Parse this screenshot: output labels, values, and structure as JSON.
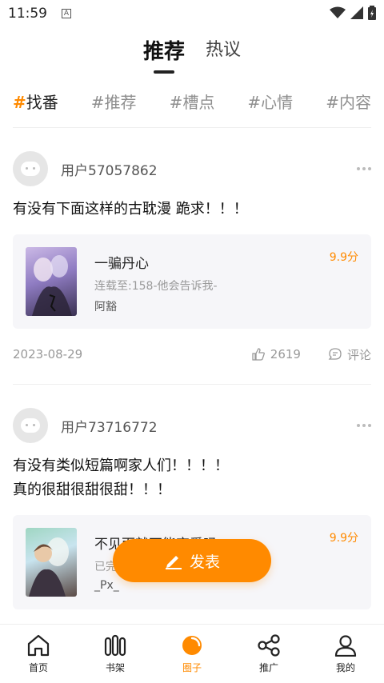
{
  "status_bar": {
    "time": "11:59",
    "notification_icon": "A"
  },
  "top_tabs": [
    {
      "label": "推荐",
      "active": true
    },
    {
      "label": "热议",
      "active": false
    }
  ],
  "hashtags": [
    {
      "hash": "#",
      "label": "找番",
      "active": true
    },
    {
      "hash": "#",
      "label": "推荐",
      "active": false
    },
    {
      "hash": "#",
      "label": "槽点",
      "active": false
    },
    {
      "hash": "#",
      "label": "心情",
      "active": false
    },
    {
      "hash": "#",
      "label": "内容",
      "active": false
    }
  ],
  "posts": [
    {
      "username": "用户57057862",
      "lines": [
        "有没有下面这样的古耽漫 跪求！！！"
      ],
      "comic": {
        "title": "一骗丹心",
        "progress": "连载至:158-他会告诉我-",
        "author": "阿豁",
        "score": "9.9分"
      },
      "date": "2023-08-29",
      "likes": "2619",
      "comment_label": "评论"
    },
    {
      "username": "用户73716772",
      "lines": [
        "有没有类似短篇啊家人们！！！！",
        "真的很甜很甜很甜！！！"
      ],
      "comic": {
        "title": "不见面就不能恋爱吗",
        "progress": "已完结",
        "author": "_Px_",
        "score": "9.9分"
      }
    }
  ],
  "publish_button": {
    "label": "发表"
  },
  "bottom_nav": [
    {
      "label": "首页",
      "icon": "home-icon",
      "active": false
    },
    {
      "label": "书架",
      "icon": "bookshelf-icon",
      "active": false
    },
    {
      "label": "圈子",
      "icon": "circle-icon",
      "active": true
    },
    {
      "label": "推广",
      "icon": "share-icon",
      "active": false
    },
    {
      "label": "我的",
      "icon": "profile-icon",
      "active": false
    }
  ],
  "colors": {
    "accent": "#ff8a00",
    "card_bg": "#f6f6f9",
    "muted_text": "#999999"
  }
}
